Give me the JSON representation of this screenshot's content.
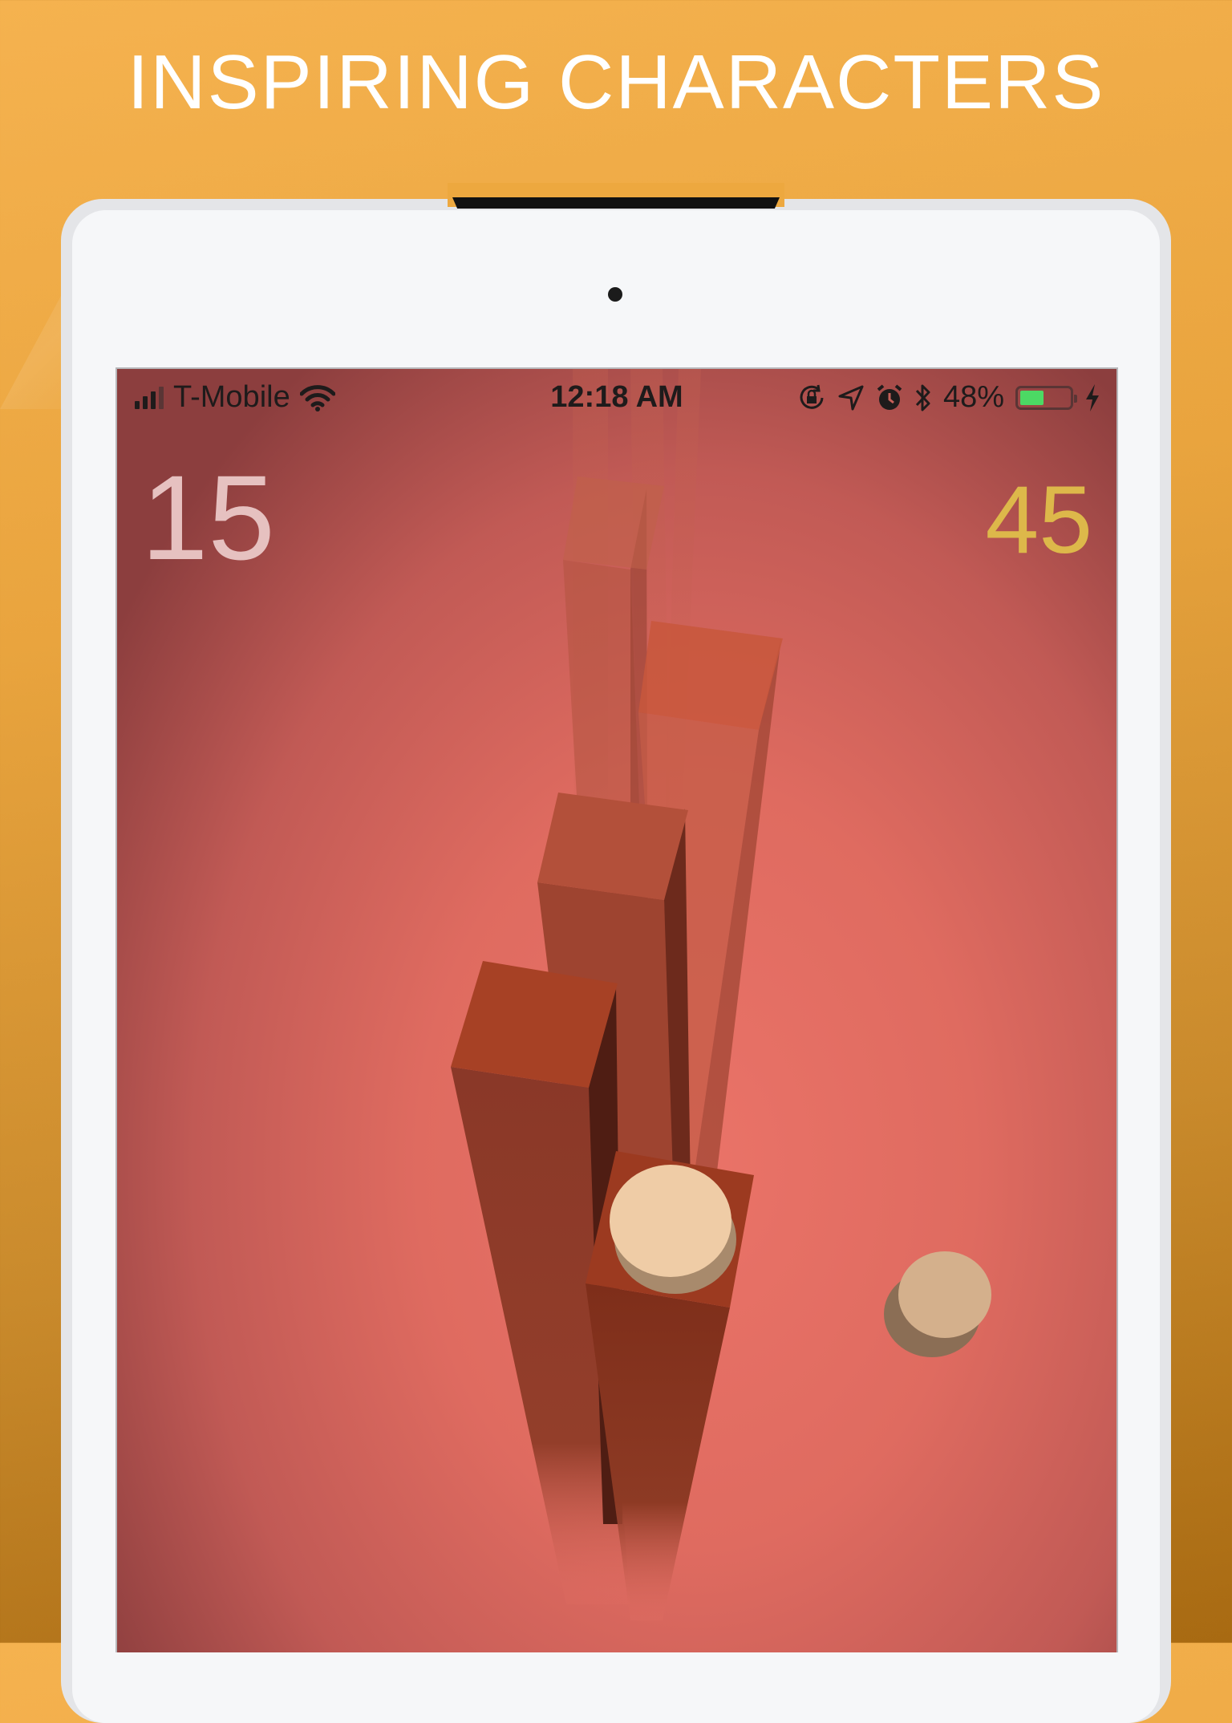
{
  "headline": "INSPIRING CHARACTERS",
  "status_bar": {
    "carrier": "T-Mobile",
    "time": "12:18 AM",
    "battery_percent": "48%",
    "battery_level": 0.48,
    "signal_bars": 4,
    "icons": [
      "signal-icon",
      "wifi-icon",
      "rotation-lock-icon",
      "location-icon",
      "alarm-icon",
      "bluetooth-icon",
      "battery-icon",
      "charging-icon"
    ]
  },
  "game": {
    "score": "15",
    "coins": "45",
    "colors": {
      "background_center": "#ea7368",
      "pillar_top": "#a9442a",
      "pillar_side": "#8a3522",
      "player": "#efcca6",
      "coin_color": "#ddb84a"
    }
  }
}
